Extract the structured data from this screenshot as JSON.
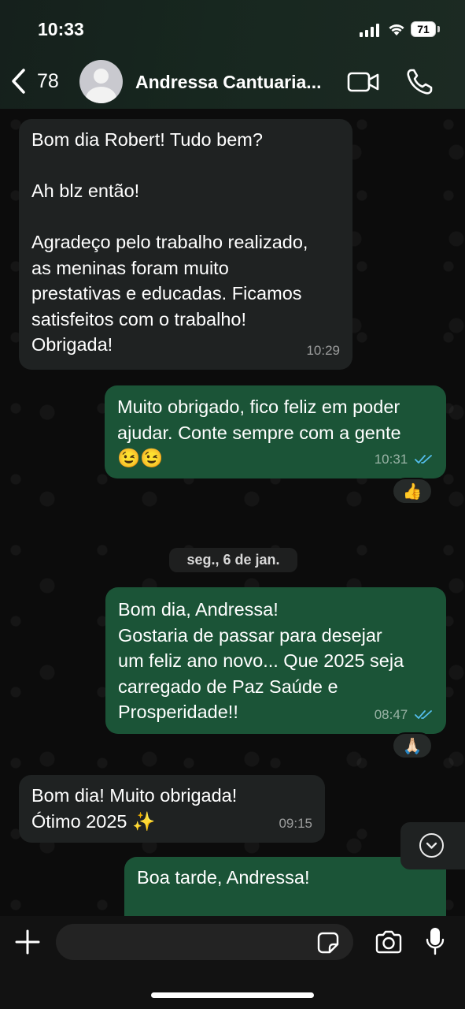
{
  "status_bar": {
    "time": "10:33",
    "battery": "71"
  },
  "header": {
    "back_count": "78",
    "contact_name": "Andressa Cantuaria..."
  },
  "messages": [
    {
      "direction": "incoming",
      "text": "Bom dia Robert! Tudo bem?\n\nAh blz então!\n\nAgradeço pelo trabalho realizado,\nas meninas foram muito\nprestativas e educadas. Ficamos\nsatisfeitos com o trabalho!\nObrigada!",
      "time": "10:29"
    },
    {
      "direction": "outgoing",
      "text": "Muito obrigado, fico feliz em poder\najudar. Conte sempre com a gente\n😉😉",
      "time": "10:31",
      "reaction": "👍"
    },
    {
      "direction": "outgoing",
      "text": "Bom dia, Andressa!\nGostaria de passar para desejar\num feliz ano novo... Que 2025 seja\ncarregado de Paz Saúde e\nProsperidade!!",
      "time": "08:47",
      "reaction": "🙏🏻"
    },
    {
      "direction": "incoming",
      "text": "Bom dia! Muito obrigada!\nÓtimo 2025 ✨",
      "time": "09:15"
    },
    {
      "direction": "outgoing",
      "text": "Boa tarde, Andressa!",
      "time": ""
    }
  ],
  "date_separator": "seg., 6 de jan.",
  "composer": {
    "placeholder": ""
  },
  "colors": {
    "outgoing_bubble": "#1b5437",
    "incoming_bubble": "#1f2222",
    "read_ticks": "#53bdeb"
  }
}
